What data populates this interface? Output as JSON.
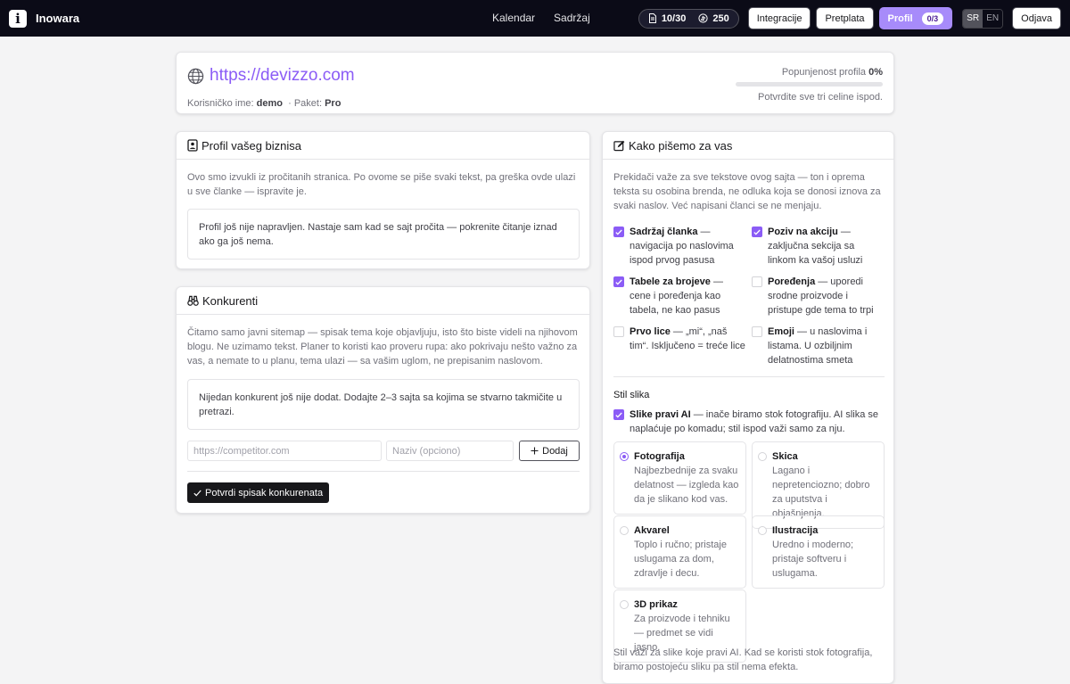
{
  "nav": {
    "brand": "Inowara",
    "links": [
      "Kalendar",
      "Sadržaj"
    ],
    "credits": {
      "articles": "10/30",
      "coins": "250"
    },
    "buttons": {
      "integrations": "Integracije",
      "subscription": "Pretplata",
      "profile": "Profil",
      "profile_progress": "0/3",
      "logout": "Odjava"
    },
    "langs": [
      "SR",
      "EN"
    ],
    "active_lang": "SR"
  },
  "site": {
    "url": "https://devizzo.com",
    "username_label": "Korisničko ime:",
    "username": "demo",
    "plan_label": "· Paket:",
    "plan": "Pro",
    "progress_label": "Popunjenost profila",
    "progress_value": "0%",
    "progress_fraction": 0,
    "progress_hint": "Potvrdite sve tri celine ispod."
  },
  "business": {
    "title": "Profil vašeg biznisa",
    "intro": "Ovo smo izvukli iz pročitanih stranica. Po ovome se piše svaki tekst, pa greška ovde ulazi u sve članke — ispravite je.",
    "empty": "Profil još nije napravljen. Nastaje sam kad se sajt pročita — pokrenite čitanje iznad ako ga još nema."
  },
  "competitors": {
    "title": "Konkurenti",
    "intro": "Čitamo samo javni sitemap — spisak tema koje objavljuju, isto što biste videli na njihovom blogu. Ne uzimamo tekst. Planer to koristi kao proveru rupa: ako pokrivaju nešto važno za vas, a nemate to u planu, tema ulazi — sa vašim uglom, ne prepisanim naslovom.",
    "empty": "Nijedan konkurent još nije dodat. Dodajte 2–3 sajta sa kojima se stvarno takmičite u pretrazi.",
    "url_placeholder": "https://competitor.com",
    "name_placeholder": "Naziv (opciono)",
    "add_label": "Dodaj",
    "confirm_label": "Potvrdi spisak konkurenata"
  },
  "writing": {
    "title": "Kako pišemo za vas",
    "intro": "Prekidači važe za sve tekstove ovog sajta — ton i oprema teksta su osobina brenda, ne odluka koja se donosi iznova za svaki naslov. Već napisani članci se ne menjaju.",
    "toggles": [
      {
        "title": "Sadržaj članka",
        "desc": " — navigacija po naslovima ispod prvog pasusa",
        "checked": true
      },
      {
        "title": "Poziv na akciju",
        "desc": " — zaključna sekcija sa linkom ka vašoj usluzi",
        "checked": true
      },
      {
        "title": "Tabele za brojeve",
        "desc": " — cene i poređenja kao tabela, ne kao pasus",
        "checked": true
      },
      {
        "title": "Poređenja",
        "desc": " — uporedi srodne proizvode i pristupe gde tema to trpi",
        "checked": false
      },
      {
        "title": "Prvo lice",
        "desc": " — „mi“, „naš tim“. Isključeno = treće lice",
        "checked": false
      },
      {
        "title": "Emoji",
        "desc": " — u naslovima i listama. U ozbiljnim delatnostima smeta",
        "checked": false
      }
    ],
    "image_style": {
      "heading": "Stil slika",
      "ai_title": "Slike pravi AI",
      "ai_desc": " — inače biramo stok fotografiju. AI slika se naplaćuje po komadu; stil ispod važi samo za nju.",
      "ai_checked": true,
      "options": [
        {
          "title": "Fotografija",
          "desc": "Najbezbednije za svaku delatnost — izgleda kao da je slikano kod vas.",
          "selected": true
        },
        {
          "title": "Skica",
          "desc": "Lagano i nepretenciozno; dobro za uputstva i objašnjenja.",
          "selected": false
        },
        {
          "title": "Akvarel",
          "desc": "Toplo i ručno; pristaje uslugama za dom, zdravlje i decu.",
          "selected": false
        },
        {
          "title": "Ilustracija",
          "desc": "Uredno i moderno; pristaje softveru i uslugama.",
          "selected": false
        },
        {
          "title": "3D prikaz",
          "desc": "Za proizvode i tehniku — predmet se vidi jasno.",
          "selected": false
        }
      ],
      "footnote": "Stil važi za slike koje pravi AI. Kad se koristi stok fotografija, biramo postojeću sliku pa stil nema efekta."
    }
  },
  "colors": {
    "accent": "#8b5cf6",
    "nav_bg": "#0b0b17"
  },
  "icons": [
    "document-icon",
    "coin-icon",
    "globe-icon",
    "id-card-icon",
    "binoculars-icon",
    "pencil-square-icon",
    "plus-icon",
    "check-icon"
  ]
}
